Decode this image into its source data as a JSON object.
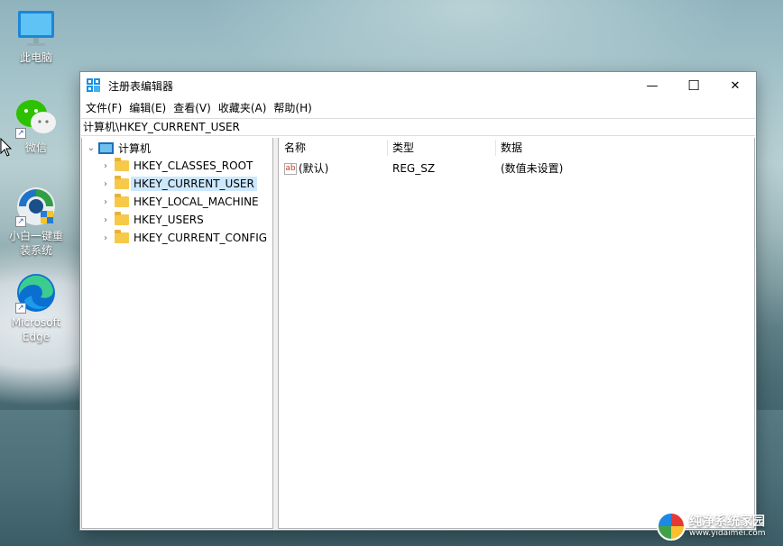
{
  "desktop": {
    "icons": [
      {
        "label": "此电脑",
        "icon": "this-pc-icon"
      },
      {
        "label": "微信",
        "icon": "wechat-icon"
      },
      {
        "label": "小白一键重装系统",
        "icon": "xiaobai-reinstall-icon"
      },
      {
        "label": "Microsoft Edge",
        "icon": "edge-icon"
      }
    ]
  },
  "window": {
    "title": "注册表编辑器",
    "controls": {
      "minimize": "—",
      "maximize": "☐",
      "close": "✕"
    },
    "menu": [
      "文件(F)",
      "编辑(E)",
      "查看(V)",
      "收藏夹(A)",
      "帮助(H)"
    ],
    "address": "计算机\\HKEY_CURRENT_USER",
    "tree": {
      "root": "计算机",
      "children": [
        {
          "label": "HKEY_CLASSES_ROOT"
        },
        {
          "label": "HKEY_CURRENT_USER",
          "selected": true
        },
        {
          "label": "HKEY_LOCAL_MACHINE"
        },
        {
          "label": "HKEY_USERS"
        },
        {
          "label": "HKEY_CURRENT_CONFIG"
        }
      ]
    },
    "list": {
      "columns": [
        "名称",
        "类型",
        "数据"
      ],
      "rows": [
        {
          "name": "(默认)",
          "type": "REG_SZ",
          "data": "(数值未设置)"
        }
      ]
    }
  },
  "watermark": {
    "title": "纯净系统家园",
    "url": "www.yidaimei.com"
  },
  "colors": {
    "selection": "#cce8ff",
    "folder": "#f7c948"
  }
}
